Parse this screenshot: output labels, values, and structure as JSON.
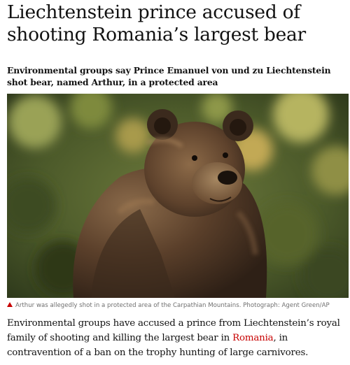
{
  "article": {
    "headline": "Liechtenstein prince accused of shooting Romania’s largest bear",
    "standfirst": "Environmental groups say Prince Emanuel von und zu Liechtenstein shot bear, named Arthur, in a protected area",
    "caption": "Arthur was allegedly shot in a protected area of the Carpathian Mountains. Photograph: Agent Green/AP",
    "body": {
      "before_link": "Environmental groups have accused a prince from Liechtenstein’s royal family of shooting and killing the largest bear in ",
      "link_text": "Romania",
      "after_link": ", in contravention of a ban on the trophy hunting of large carnivores."
    }
  },
  "colors": {
    "link": "#c70000",
    "caption_triangle": "#c70000",
    "caption_text": "#707070"
  }
}
